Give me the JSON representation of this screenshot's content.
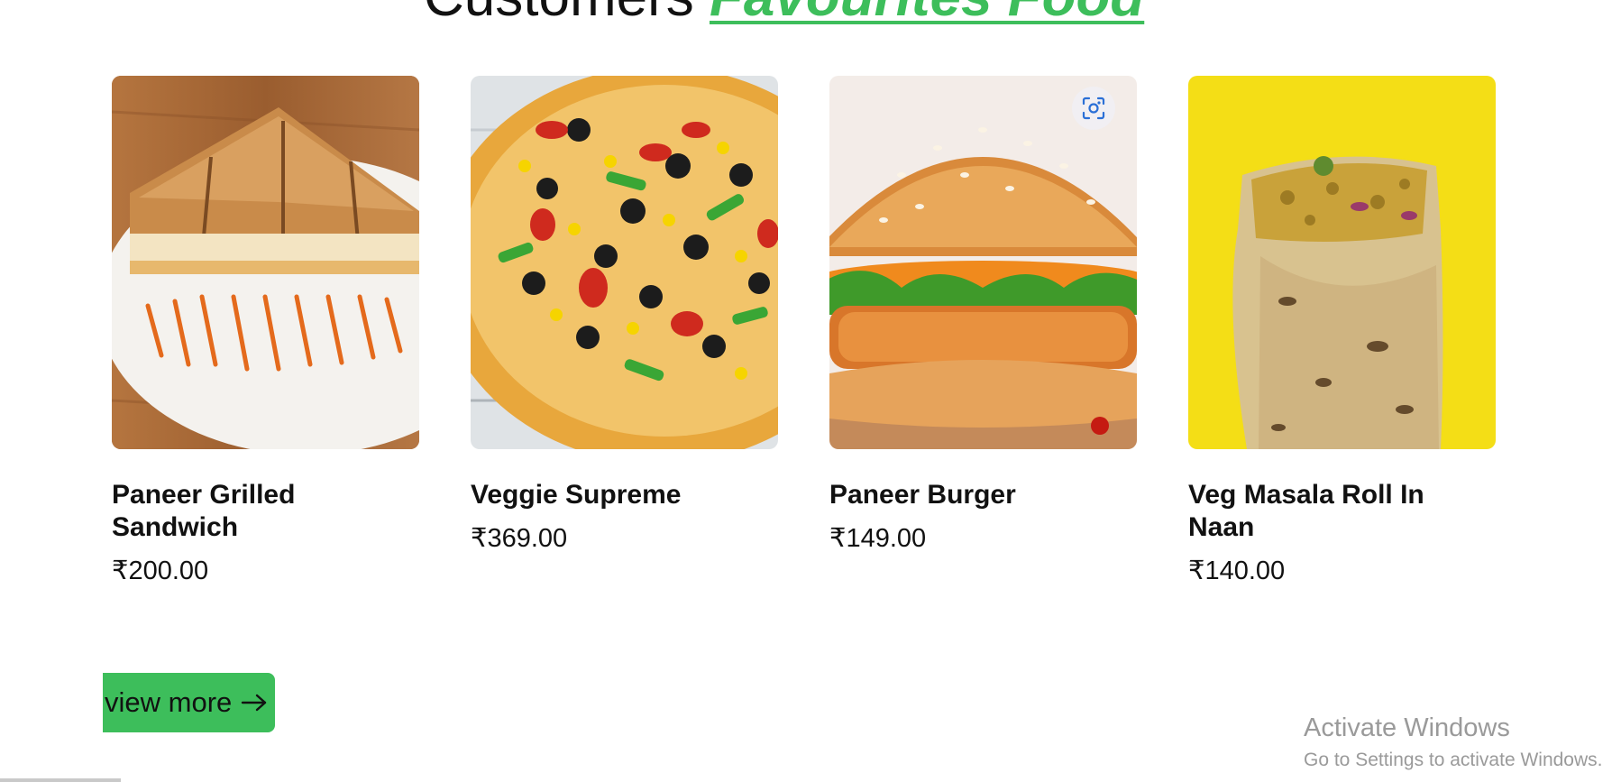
{
  "section": {
    "heading_prefix": "Customers",
    "heading_accent": "Favourites Food"
  },
  "colors": {
    "accent": "#3dbe5b",
    "burrito_bg": "#f4de16"
  },
  "products": [
    {
      "name": "Paneer Grilled Sandwich",
      "price": "₹200.00",
      "image": "sandwich"
    },
    {
      "name": "Veggie Supreme",
      "price": "₹369.00",
      "image": "pizza"
    },
    {
      "name": "Paneer Burger",
      "price": "₹149.00",
      "image": "burger"
    },
    {
      "name": "Veg Masala Roll In Naan",
      "price": "₹140.00",
      "image": "roll"
    }
  ],
  "view_more": {
    "label": "view more",
    "icon": "arrow-right-icon"
  },
  "image_search": {
    "icon": "visual-search-lens-icon"
  },
  "watermark": {
    "title": "Activate Windows",
    "subtitle": "Go to Settings to activate Windows."
  }
}
